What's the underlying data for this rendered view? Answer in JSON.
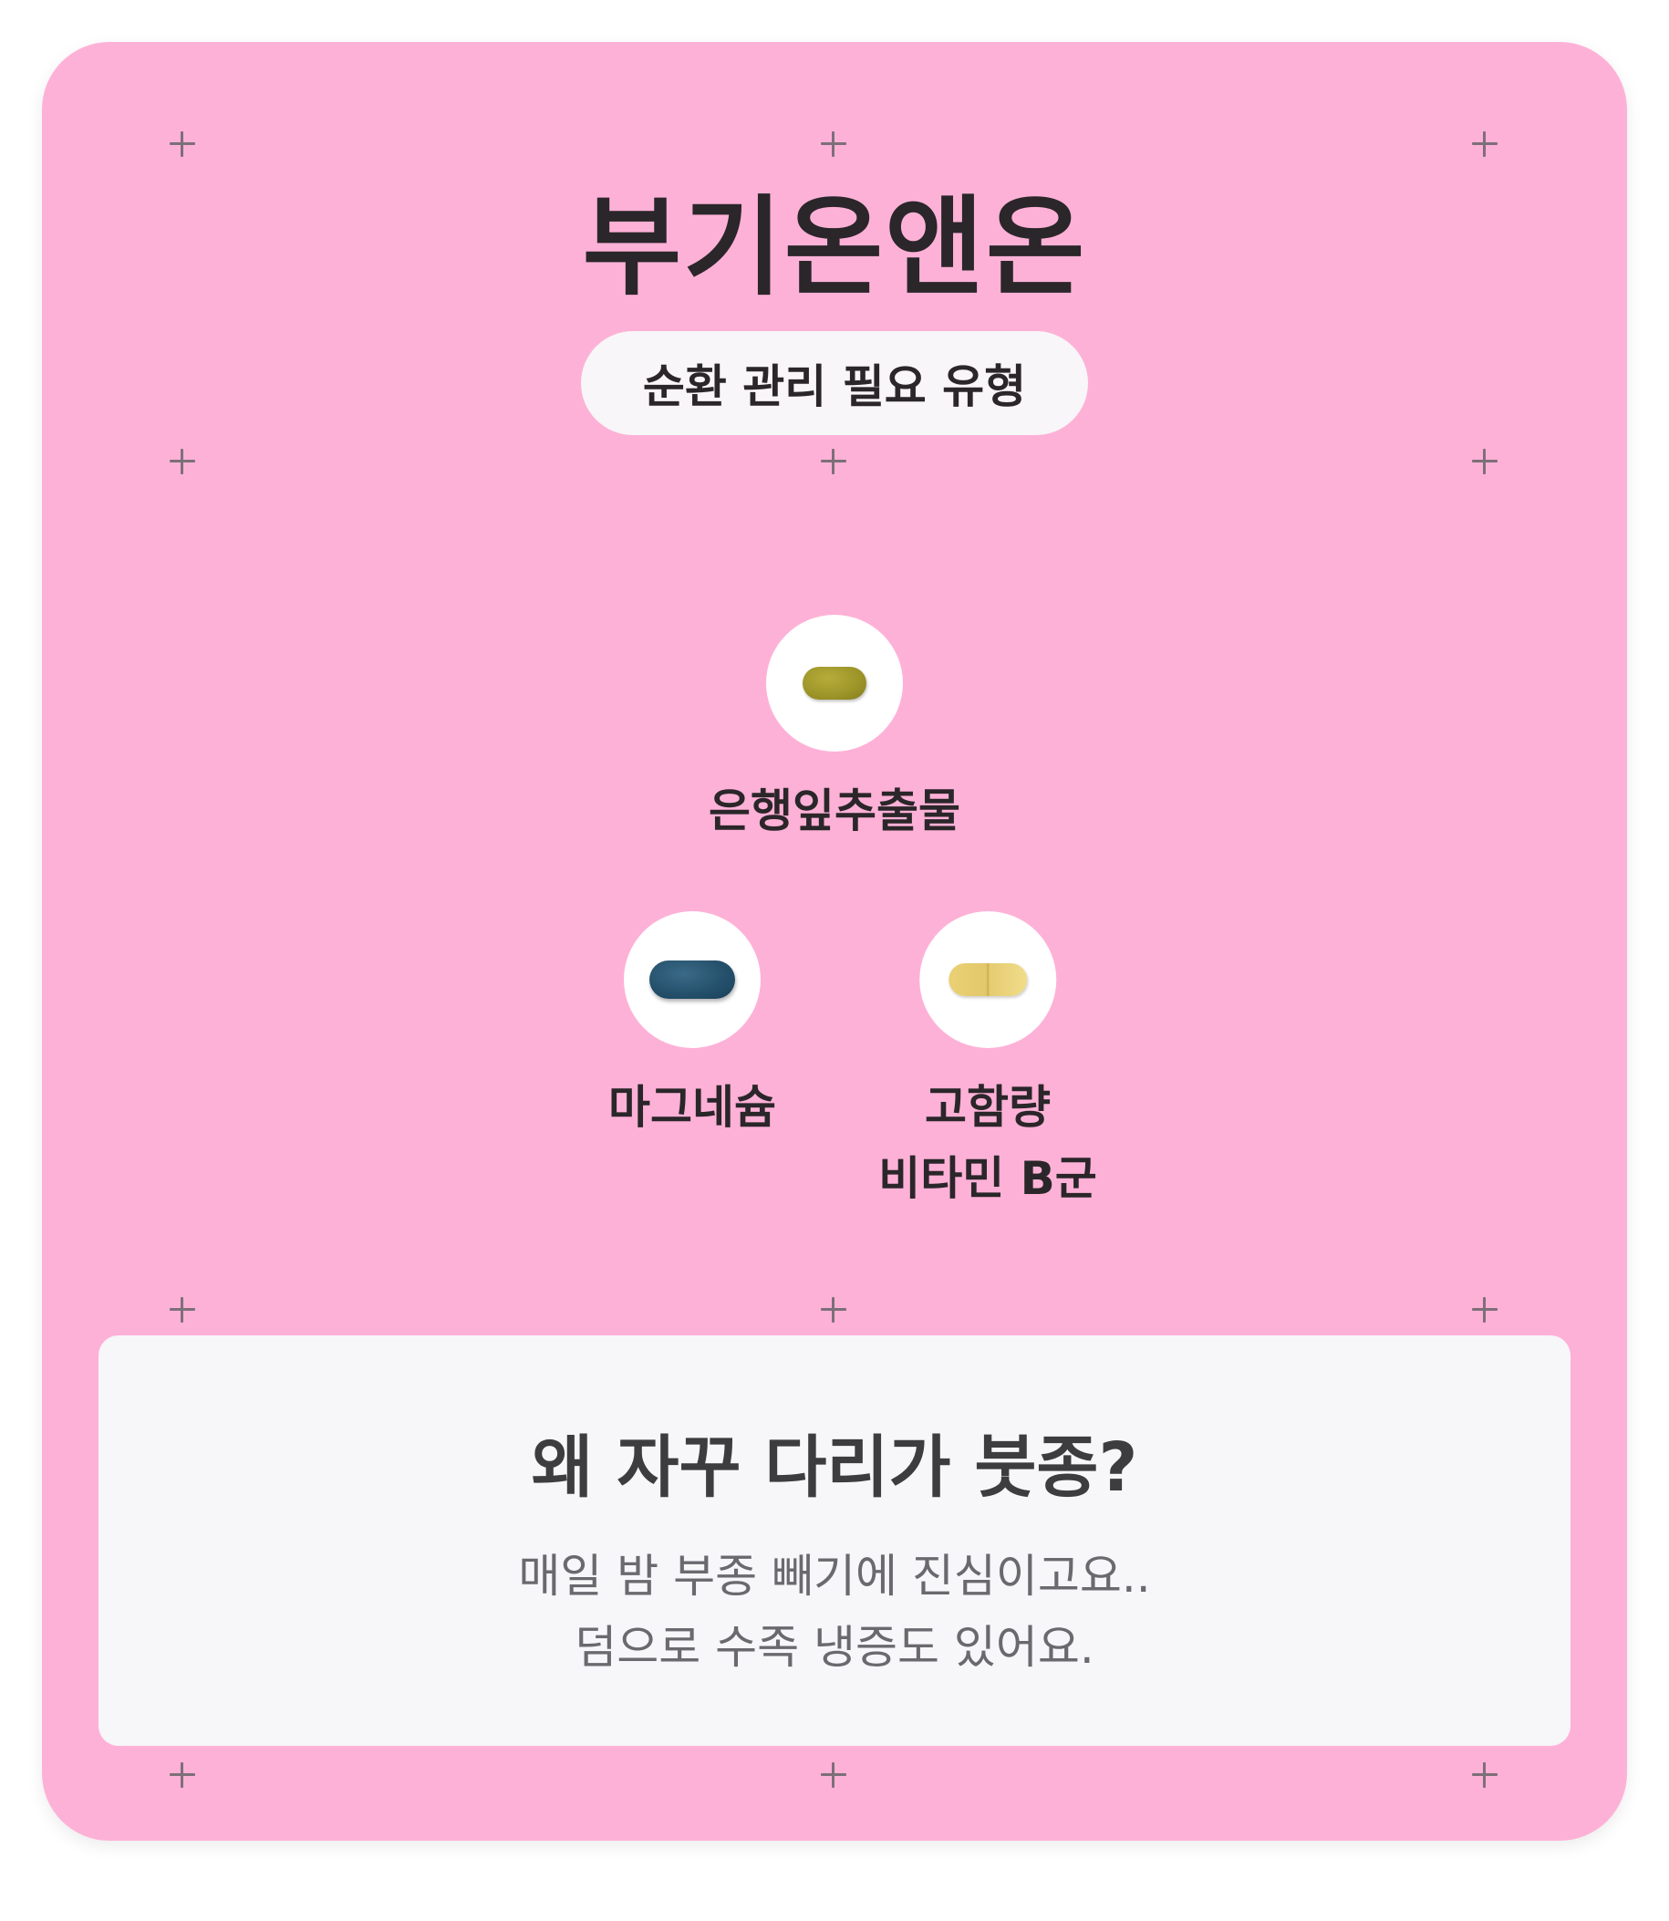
{
  "title": "부기온앤온",
  "badge": "순환 관리 필요 유형",
  "ingredients": [
    {
      "name_line1": "은행잎추출물",
      "name_line2": "",
      "pill_icon": "olive-oval-pill-icon"
    },
    {
      "name_line1": "마그네슘",
      "name_line2": "",
      "pill_icon": "blue-oval-pill-icon"
    },
    {
      "name_line1": "고함량",
      "name_line2": "비타민 B군",
      "pill_icon": "yellow-capsule-pill-icon"
    }
  ],
  "info": {
    "heading": "왜 자꾸 다리가 붓종?",
    "line1": "매일 밤 부종 빼기에 진심이고요..",
    "line2": "덤으로 수족 냉증도 있어요."
  },
  "colors": {
    "card_background": "#FEB1D7",
    "panel_background": "#F7F6F9",
    "text_dark": "#2A2629",
    "text_muted": "#6A6A6E",
    "plus_marker": "#7D6F79"
  }
}
